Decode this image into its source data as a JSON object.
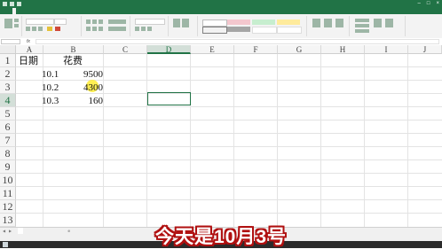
{
  "titlebar": {
    "title": "",
    "account": "",
    "min_glyph": "–",
    "max_glyph": "□",
    "close_glyph": "×"
  },
  "ribbon_tabs": [
    "",
    "",
    "",
    "",
    "",
    "",
    "",
    "",
    ""
  ],
  "active_tab_index": 1,
  "formula_bar": {
    "name_box": "",
    "fx": "fx",
    "value": ""
  },
  "columns": [
    "A",
    "B",
    "C",
    "D",
    "E",
    "F",
    "G",
    "H",
    "I",
    "J"
  ],
  "selected_column": "D",
  "rows": [
    "1",
    "2",
    "3",
    "4",
    "5",
    "6",
    "7",
    "8",
    "9",
    "10",
    "11",
    "12",
    "13"
  ],
  "selected_row": "4",
  "cells": {
    "A1": "日期",
    "B1": "花费",
    "A2": "10.1",
    "B2": "9500",
    "A3": "10.2",
    "B3": "4300",
    "A4": "10.3",
    "B4": "160"
  },
  "sheet_tabs": [
    "",
    "",
    ""
  ],
  "active_sheet_index": 0,
  "status_text": "",
  "clock": "",
  "caption": "今天是10月3号",
  "colors": {
    "accent": "#217346",
    "caption_outline": "#b01010"
  }
}
